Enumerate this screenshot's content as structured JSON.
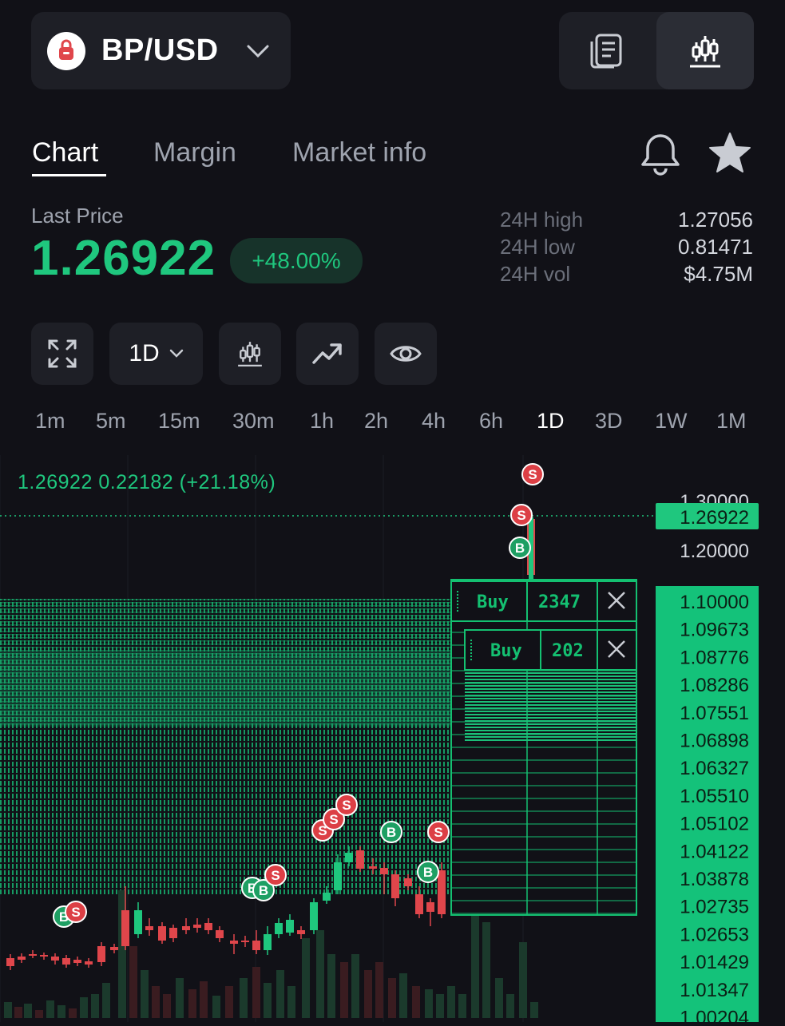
{
  "pair": {
    "name": "BP/USD"
  },
  "tabs": [
    {
      "label": "Chart",
      "active": true
    },
    {
      "label": "Margin",
      "active": false
    },
    {
      "label": "Market info",
      "active": false
    }
  ],
  "price": {
    "label": "Last Price",
    "value": "1.26922",
    "change": "+48.00%"
  },
  "stats": [
    {
      "label": "24H high",
      "value": "1.27056"
    },
    {
      "label": "24H low",
      "value": "0.81471"
    },
    {
      "label": "24H vol",
      "value": "$4.75M"
    }
  ],
  "toolbar": {
    "interval": "1D"
  },
  "timeframes": [
    "1m",
    "5m",
    "15m",
    "30m",
    "1h",
    "2h",
    "4h",
    "6h",
    "1D",
    "3D",
    "1W",
    "1M"
  ],
  "active_timeframe": "1D",
  "chart": {
    "legend": "1.26922  0.22182 (+21.18%)",
    "current_price_tag": "1.26922",
    "axis_labels": [
      "1.30000",
      "1.20000"
    ],
    "order_levels": [
      "1.10000",
      "1.09673",
      "1.08776",
      "1.08286",
      "1.07551",
      "1.06898",
      "1.06327",
      "1.05510",
      "1.05102",
      "1.04122",
      "1.03878",
      "1.02735",
      "1.02653",
      "1.01429",
      "1.01347",
      "1.00204"
    ],
    "orders": [
      {
        "side": "Buy",
        "qty": "2347"
      },
      {
        "side": "Buy",
        "qty": "202"
      }
    ],
    "marker_b": "B",
    "marker_s": "S"
  },
  "colors": {
    "up": "#1fc77e",
    "down": "#e0464b",
    "bg": "#111117",
    "panel": "#1e1f26"
  }
}
